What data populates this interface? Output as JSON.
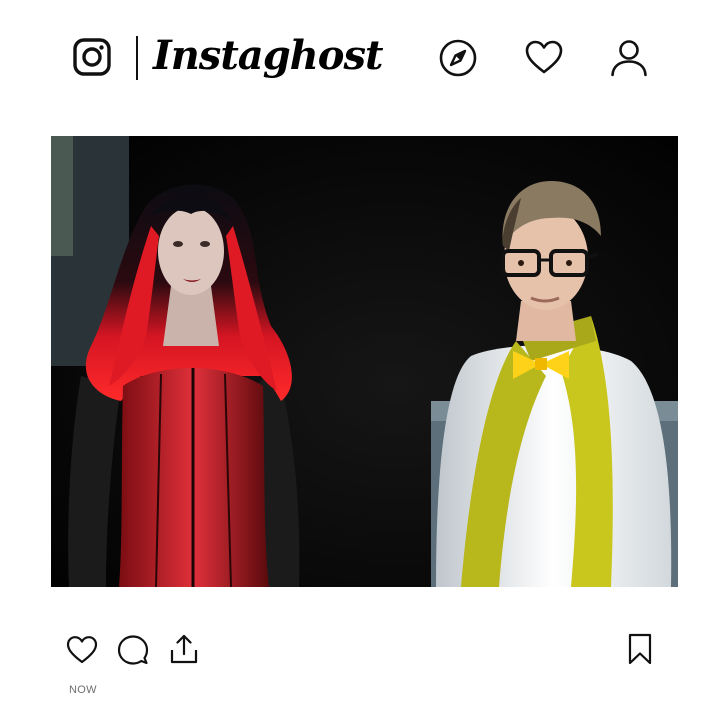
{
  "header": {
    "app_name": "Instaghost",
    "logo_icon": "camera-logo-icon",
    "nav_icons": [
      "compass-icon",
      "heart-icon",
      "user-icon"
    ]
  },
  "post": {
    "image_description_icon": "photo",
    "timestamp": "NOW"
  },
  "actions": {
    "icons": [
      "heart-icon",
      "comment-icon",
      "share-icon",
      "bookmark-icon"
    ]
  },
  "colors": {
    "background": "#ffffff",
    "icon": "#111111",
    "timestamp": "#6f6f6f",
    "photo_background": "#050505"
  }
}
